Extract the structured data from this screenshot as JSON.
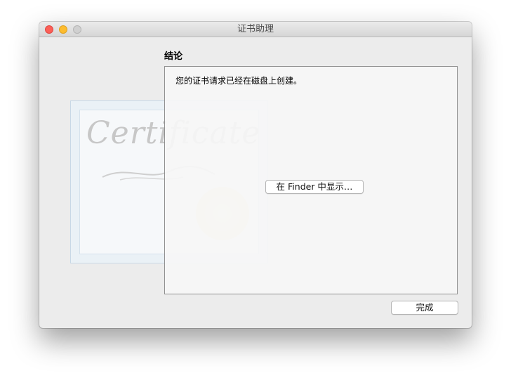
{
  "window": {
    "title": "证书助理"
  },
  "section": {
    "heading": "结论"
  },
  "content": {
    "message": "您的证书请求已经在磁盘上创建。",
    "finder_button_label": "在 Finder 中显示…"
  },
  "certificate_graphic": {
    "text": "Certificate"
  },
  "footer": {
    "done_label": "完成"
  },
  "colors": {
    "close": "#fc5f57",
    "minimize": "#fdbc2e",
    "zoom_disabled": "#d0d0d0",
    "window_bg": "#ececec"
  }
}
